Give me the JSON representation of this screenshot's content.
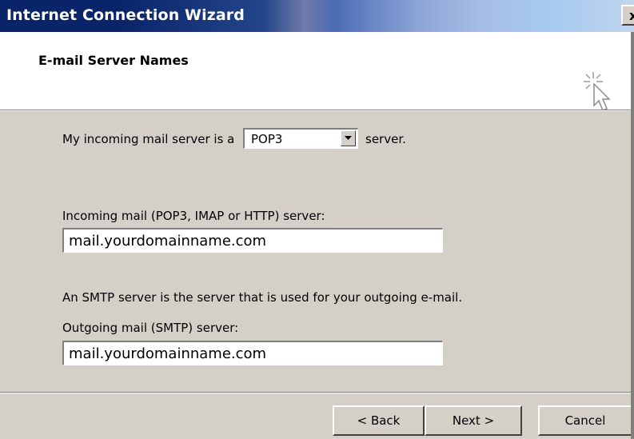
{
  "window": {
    "title": "Internet Connection Wizard",
    "close_glyph": "x"
  },
  "header": {
    "title": "E-mail Server Names",
    "icon": "wizard-cursor-icon"
  },
  "incoming_type": {
    "prefix": "My incoming mail server is a",
    "selected": "POP3",
    "suffix": "server."
  },
  "incoming_server": {
    "label": "Incoming mail (POP3, IMAP or HTTP) server:",
    "value": "mail.yourdomainname.com"
  },
  "smtp_note": "An SMTP server is the server that is used for your outgoing e-mail.",
  "outgoing_server": {
    "label": "Outgoing mail (SMTP) server:",
    "value": "mail.yourdomainname.com"
  },
  "buttons": {
    "back": "< Back",
    "next": "Next >",
    "cancel": "Cancel"
  }
}
